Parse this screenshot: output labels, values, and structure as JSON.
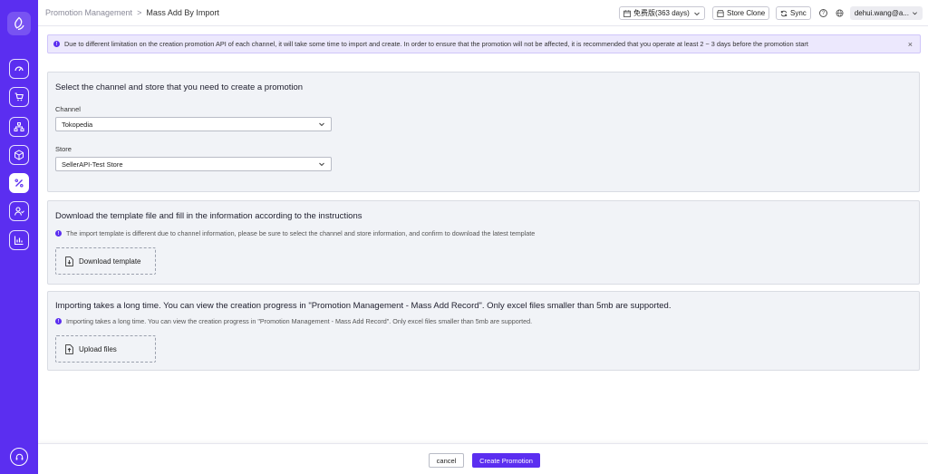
{
  "breadcrumb": {
    "parent": "Promotion Management",
    "separator": ">",
    "current": "Mass Add By Import"
  },
  "topbar": {
    "plan_label": "免费版(363 days)",
    "store_clone_label": "Store Clone",
    "sync_label": "Sync",
    "help_glyph": "?",
    "user_label": "dehui.wang@a..."
  },
  "notice": {
    "text": "Due to different limitation on the creation promotion API of each channel, it will take some time to import and create. In order to ensure that the promotion will not be affected, it is recommended that you operate at least 2 ~ 3 days before the promotion start",
    "close_glyph": "×"
  },
  "select_section": {
    "title": "Select the channel and store that you need to create a promotion",
    "channel_label": "Channel",
    "channel_value": "Tokopedia",
    "store_label": "Store",
    "store_value": "SellerAPI-Test Store"
  },
  "download_section": {
    "title": "Download the template file and fill in the information according to the instructions",
    "hint": "The import template is different due to channel information, please be sure to select the channel and store information, and confirm to download the latest template",
    "button_label": "Download template"
  },
  "upload_section": {
    "title": "Importing takes a long time. You can view the creation progress in \"Promotion Management - Mass Add Record\". Only excel files smaller than 5mb are supported.",
    "hint": "Importing takes a long time. You can view the creation progress in \"Promotion Management - Mass Add Record\". Only excel files smaller than 5mb are supported.",
    "button_label": "Upload files"
  },
  "footer": {
    "cancel_label": "cancel",
    "create_label": "Create Promotion"
  },
  "info_glyph": "!",
  "colors": {
    "brand": "#5b2ef0",
    "notice_bg": "#ece8fd",
    "card_bg": "#f1f3f7"
  },
  "sidebar": {
    "items": [
      {
        "icon": "dashboard-icon"
      },
      {
        "icon": "cart-icon"
      },
      {
        "icon": "sitemap-icon"
      },
      {
        "icon": "box-icon"
      },
      {
        "icon": "percent-icon",
        "active": true
      },
      {
        "icon": "customers-icon"
      },
      {
        "icon": "chart-icon"
      }
    ],
    "bottom_icon": "headset-icon"
  }
}
